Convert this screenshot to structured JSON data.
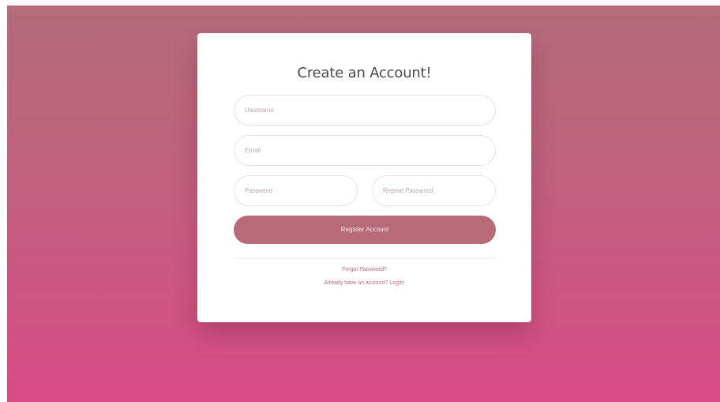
{
  "form": {
    "title": "Create an Account!",
    "fields": {
      "username": {
        "placeholder": "Username",
        "value": ""
      },
      "email": {
        "placeholder": "Email",
        "value": ""
      },
      "password": {
        "placeholder": "Password",
        "value": ""
      },
      "repeat_password": {
        "placeholder": "Repeat Password",
        "value": ""
      }
    },
    "submit_label": "Register Account",
    "forgot_password_link": "Forgot Password?",
    "login_link": "Already have an account? Login!"
  },
  "colors": {
    "background_top": "#b36c78",
    "background_bottom": "#d84b84",
    "button": "#b76b78",
    "link": "#b46f7d"
  }
}
